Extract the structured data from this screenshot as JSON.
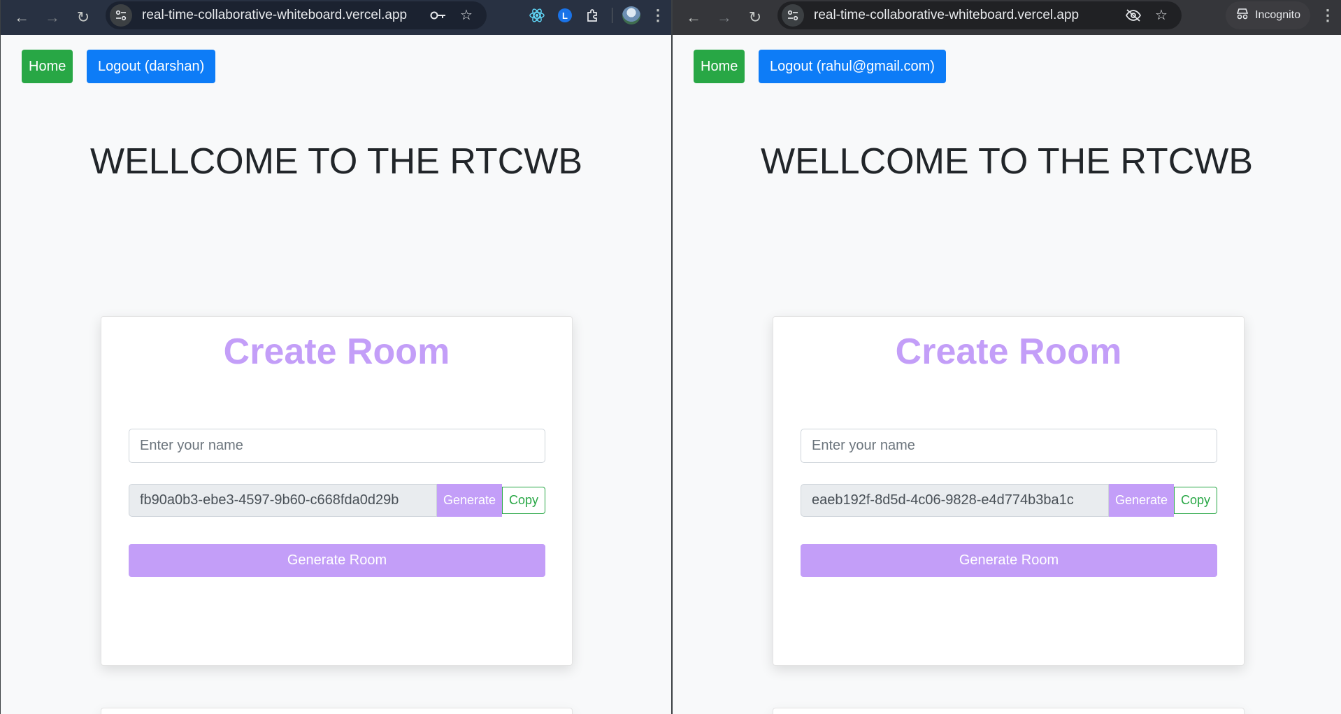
{
  "left_window": {
    "url": "real-time-collaborative-whiteboard.vercel.app",
    "nav": {
      "home_label": "Home",
      "logout_label": "Logout (darshan)"
    },
    "welcome_title": "WELLCOME TO THE RTCWB",
    "card": {
      "title": "Create Room",
      "name_placeholder": "Enter your name",
      "room_id": "fb90a0b3-ebe3-4597-9b60-c668fda0d29b",
      "generate_label": "Generate",
      "copy_label": "Copy",
      "generate_room_label": "Generate Room"
    }
  },
  "right_window": {
    "url": "real-time-collaborative-whiteboard.vercel.app",
    "incognito_label": "Incognito",
    "nav": {
      "home_label": "Home",
      "logout_label": "Logout (rahul@gmail.com)"
    },
    "welcome_title": "WELLCOME TO THE RTCWB",
    "card": {
      "title": "Create Room",
      "name_placeholder": "Enter your name",
      "room_id": "eaeb192f-8d5d-4c06-9828-e4d774b3ba1c",
      "generate_label": "Generate",
      "copy_label": "Copy",
      "generate_room_label": "Generate Room"
    }
  },
  "icons": {
    "back": "arrow-left-icon",
    "forward": "arrow-right-icon",
    "reload": "reload-icon",
    "site_info": "tune-icon",
    "password_key": "key-icon",
    "bookmark": "star-icon",
    "react_devtools": "react-icon",
    "extension_l": "lastpass-icon",
    "extensions": "puzzle-icon",
    "profile": "avatar-icon",
    "menu": "kebab-menu-icon",
    "eye_off": "eye-off-icon",
    "incognito": "incognito-icon"
  },
  "colors": {
    "home_button": "#28a745",
    "logout_button": "#0d7cf7",
    "accent_purple": "#c39ef8",
    "copy_green": "#28a745",
    "page_bg": "#f8f9fa"
  }
}
